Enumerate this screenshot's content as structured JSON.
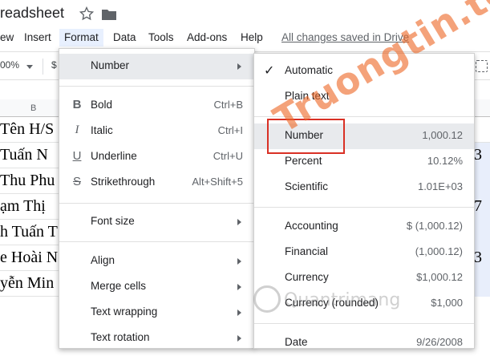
{
  "title_bar": {
    "doc_title": "readsheet",
    "star_icon": "star-icon",
    "folder_icon": "folder-icon"
  },
  "menu_bar": {
    "items": [
      "ew",
      "Insert",
      "Format",
      "Data",
      "Tools",
      "Add-ons",
      "Help"
    ],
    "save_status": "All changes saved in Drive"
  },
  "toolbar": {
    "zoom": "00%",
    "currency": "$"
  },
  "grid": {
    "column_header": "B",
    "rows": [
      {
        "b": "Tên H/S",
        "right": ""
      },
      {
        "b": "Tuấn N",
        "right": "3"
      },
      {
        "b": "Thu Phu",
        "right": ""
      },
      {
        "b": "ạm Thị",
        "right": "7"
      },
      {
        "b": "h Tuấn T",
        "right": ""
      },
      {
        "b": "e Hoài N",
        "right": "3"
      },
      {
        "b": "yễn Min",
        "right": ""
      }
    ]
  },
  "format_menu": {
    "number": "Number",
    "bold": {
      "label": "Bold",
      "shortcut": "Ctrl+B"
    },
    "italic": {
      "label": "Italic",
      "shortcut": "Ctrl+I"
    },
    "underline": {
      "label": "Underline",
      "shortcut": "Ctrl+U"
    },
    "strikethrough": {
      "label": "Strikethrough",
      "shortcut": "Alt+Shift+5"
    },
    "font_size": "Font size",
    "align": "Align",
    "merge_cells": "Merge cells",
    "text_wrapping": "Text wrapping",
    "text_rotation": "Text rotation"
  },
  "number_menu": {
    "automatic": "Automatic",
    "plain_text": "Plain text",
    "number": {
      "label": "Number",
      "value": "1,000.12"
    },
    "percent": {
      "label": "Percent",
      "value": "10.12%"
    },
    "scientific": {
      "label": "Scientific",
      "value": "1.01E+03"
    },
    "accounting": {
      "label": "Accounting",
      "value": "$ (1,000.12)"
    },
    "financial": {
      "label": "Financial",
      "value": "(1,000.12)"
    },
    "currency": {
      "label": "Currency",
      "value": "$1,000.12"
    },
    "currency_rounded": {
      "label": "Currency (rounded)",
      "value": "$1,000"
    },
    "date": {
      "label": "Date",
      "value": "9/26/2008"
    }
  },
  "watermark": {
    "text": "Truongtin.top",
    "logo_text": "Quantrimang"
  },
  "colors": {
    "highlight_box": "#d93025",
    "watermark": "#ed6928",
    "menu_active_bg": "#e8f0fe"
  }
}
